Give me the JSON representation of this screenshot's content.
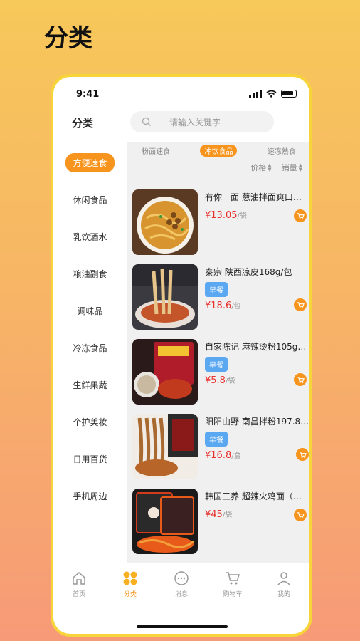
{
  "page_heading": "分类",
  "status": {
    "time": "9:41"
  },
  "header": {
    "title": "分类",
    "search_placeholder": "请输入关键字"
  },
  "sidebar": {
    "items": [
      {
        "label": "方便速食",
        "active": true
      },
      {
        "label": "休闲食品"
      },
      {
        "label": "乳饮酒水"
      },
      {
        "label": "粮油副食"
      },
      {
        "label": "调味品"
      },
      {
        "label": "冷冻食品"
      },
      {
        "label": "生鲜果蔬"
      },
      {
        "label": "个护美妆"
      },
      {
        "label": "日用百货"
      },
      {
        "label": "手机周边"
      }
    ]
  },
  "subtabs": [
    {
      "label": "粉面速食"
    },
    {
      "label": "冲饮食品",
      "active": true
    },
    {
      "label": "速冻熟食"
    }
  ],
  "sort": {
    "price": "价格",
    "sales": "销量"
  },
  "products": [
    {
      "name": "有你一面 葱油拌面爽口…",
      "tag": "",
      "price": "¥13.05",
      "unit": "/袋"
    },
    {
      "name": "秦宗 陕西凉皮168g/包",
      "tag": "早餐",
      "price": "¥18.6",
      "unit": "/包"
    },
    {
      "name": "自家陈记 麻辣烫粉105g…",
      "tag": "早餐",
      "price": "¥5.8",
      "unit": "/袋"
    },
    {
      "name": "阳阳山野 南昌拌粉197.8…",
      "tag": "早餐",
      "price": "¥16.8",
      "unit": "/盒"
    },
    {
      "name": "韩国三养 超辣火鸡面（…",
      "tag": "",
      "price": "¥45",
      "unit": "/袋"
    }
  ],
  "tabbar": {
    "items": [
      {
        "label": "首页",
        "icon": "home-icon"
      },
      {
        "label": "分类",
        "icon": "category-icon",
        "active": true
      },
      {
        "label": "消息",
        "icon": "message-icon"
      },
      {
        "label": "购物车",
        "icon": "cart-icon"
      },
      {
        "label": "我的",
        "icon": "profile-icon"
      }
    ]
  },
  "colors": {
    "accent": "#f7941d",
    "price": "#e8302b",
    "tag": "#5aa7f2",
    "frame": "#f6d43a"
  }
}
